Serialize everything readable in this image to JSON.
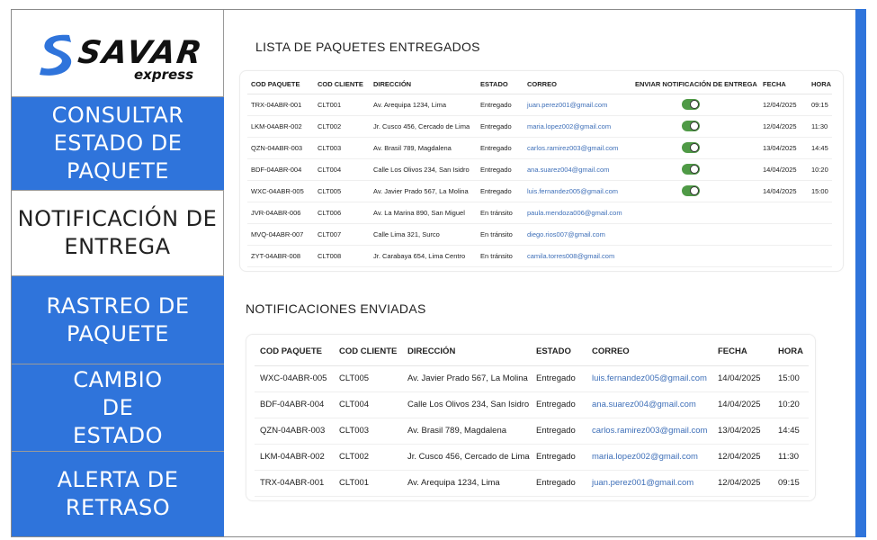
{
  "brand": {
    "name": "SAVAR",
    "sub": "express"
  },
  "nav": [
    {
      "label": "CONSULTAR ESTADO DE PAQUETE",
      "active": false
    },
    {
      "label": "NOTIFICACIÓN DE ENTREGA",
      "active": true
    },
    {
      "label": "RASTREO DE PAQUETE",
      "active": false
    },
    {
      "label": "CAMBIO DE ESTADO",
      "active": false
    },
    {
      "label": "ALERTA DE RETRASO",
      "active": false
    }
  ],
  "colors": {
    "accent": "#2f74db",
    "toggle_on": "#4f9a46",
    "link": "#3e6fb8"
  },
  "delivered": {
    "title": "LISTA DE PAQUETES ENTREGADOS",
    "columns": [
      "COD PAQUETE",
      "COD CLIENTE",
      "DIRECCIÓN",
      "ESTADO",
      "CORREO",
      "ENVIAR NOTIFICACIÓN DE ENTREGA",
      "FECHA",
      "HORA"
    ],
    "rows": [
      {
        "cod": "TRX-04ABR-001",
        "cliente": "CLT001",
        "dir": "Av. Arequipa 1234, Lima",
        "estado": "Entregado",
        "correo": "juan.perez001@gmail.com",
        "notify": true,
        "fecha": "12/04/2025",
        "hora": "09:15"
      },
      {
        "cod": "LKM-04ABR-002",
        "cliente": "CLT002",
        "dir": "Jr. Cusco 456, Cercado de Lima",
        "estado": "Entregado",
        "correo": "maria.lopez002@gmail.com",
        "notify": true,
        "fecha": "12/04/2025",
        "hora": "11:30"
      },
      {
        "cod": "QZN-04ABR-003",
        "cliente": "CLT003",
        "dir": "Av. Brasil 789, Magdalena",
        "estado": "Entregado",
        "correo": "carlos.ramirez003@gmail.com",
        "notify": true,
        "fecha": "13/04/2025",
        "hora": "14:45"
      },
      {
        "cod": "BDF-04ABR-004",
        "cliente": "CLT004",
        "dir": "Calle Los Olivos 234, San Isidro",
        "estado": "Entregado",
        "correo": "ana.suarez004@gmail.com",
        "notify": true,
        "fecha": "14/04/2025",
        "hora": "10:20"
      },
      {
        "cod": "WXC-04ABR-005",
        "cliente": "CLT005",
        "dir": "Av. Javier Prado 567, La Molina",
        "estado": "Entregado",
        "correo": "luis.fernandez005@gmail.com",
        "notify": true,
        "fecha": "14/04/2025",
        "hora": "15:00"
      },
      {
        "cod": "JVR-04ABR-006",
        "cliente": "CLT006",
        "dir": "Av. La Marina 890, San Miguel",
        "estado": "En tránsito",
        "correo": "paula.mendoza006@gmail.com",
        "notify": false,
        "fecha": "",
        "hora": ""
      },
      {
        "cod": "MVQ-04ABR-007",
        "cliente": "CLT007",
        "dir": "Calle Lima 321, Surco",
        "estado": "En tránsito",
        "correo": "diego.rios007@gmail.com",
        "notify": false,
        "fecha": "",
        "hora": ""
      },
      {
        "cod": "ZYT-04ABR-008",
        "cliente": "CLT008",
        "dir": "Jr. Carabaya 654, Lima Centro",
        "estado": "En tránsito",
        "correo": "camila.torres008@gmail.com",
        "notify": false,
        "fecha": "",
        "hora": ""
      }
    ]
  },
  "sent": {
    "title": "NOTIFICACIONES ENVIADAS",
    "columns": [
      "COD PAQUETE",
      "COD CLIENTE",
      "DIRECCIÓN",
      "ESTADO",
      "CORREO",
      "FECHA",
      "HORA"
    ],
    "rows": [
      {
        "cod": "WXC-04ABR-005",
        "cliente": "CLT005",
        "dir": "Av. Javier Prado 567, La Molina",
        "estado": "Entregado",
        "correo": "luis.fernandez005@gmail.com",
        "fecha": "14/04/2025",
        "hora": "15:00"
      },
      {
        "cod": "BDF-04ABR-004",
        "cliente": "CLT004",
        "dir": "Calle Los Olivos 234, San Isidro",
        "estado": "Entregado",
        "correo": "ana.suarez004@gmail.com",
        "fecha": "14/04/2025",
        "hora": "10:20"
      },
      {
        "cod": "QZN-04ABR-003",
        "cliente": "CLT003",
        "dir": "Av. Brasil 789, Magdalena",
        "estado": "Entregado",
        "correo": "carlos.ramirez003@gmail.com",
        "fecha": "13/04/2025",
        "hora": "14:45"
      },
      {
        "cod": "LKM-04ABR-002",
        "cliente": "CLT002",
        "dir": "Jr. Cusco 456, Cercado de Lima",
        "estado": "Entregado",
        "correo": "maria.lopez002@gmail.com",
        "fecha": "12/04/2025",
        "hora": "11:30"
      },
      {
        "cod": "TRX-04ABR-001",
        "cliente": "CLT001",
        "dir": "Av. Arequipa 1234, Lima",
        "estado": "Entregado",
        "correo": "juan.perez001@gmail.com",
        "fecha": "12/04/2025",
        "hora": "09:15"
      }
    ]
  }
}
